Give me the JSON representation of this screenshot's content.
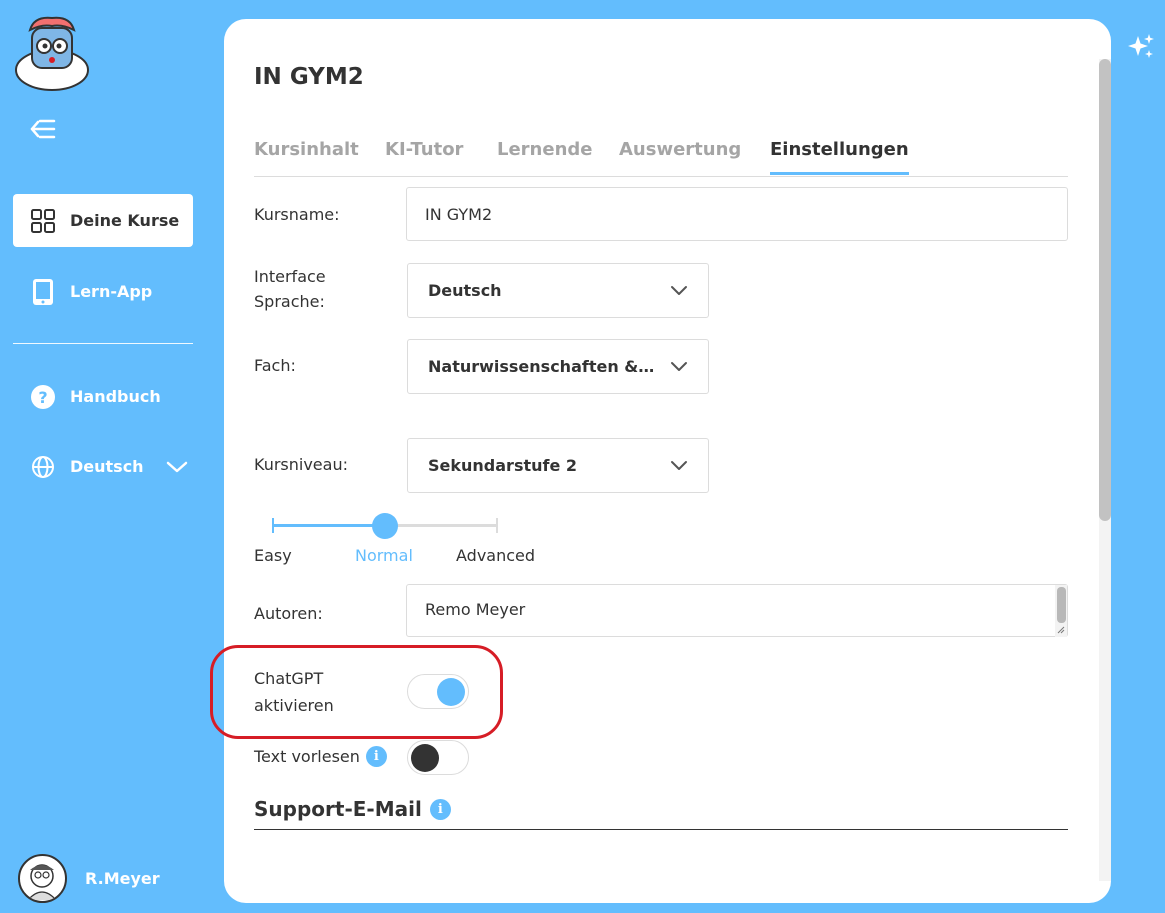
{
  "sidebar": {
    "nav": [
      {
        "label": "Deine Kurse",
        "icon": "grid-icon",
        "active": true
      },
      {
        "label": "Lern-App",
        "icon": "tablet-icon",
        "active": false
      }
    ],
    "handbuch_label": "Handbuch",
    "language_label": "Deutsch",
    "user_name": "R.Meyer"
  },
  "course": {
    "title": "IN GYM2",
    "tabs": [
      "Kursinhalt",
      "KI-Tutor",
      "Lernende",
      "Auswertung",
      "Einstellungen"
    ],
    "active_tab": "Einstellungen"
  },
  "settings": {
    "kursname_label": "Kursname:",
    "kursname_value": "IN GYM2",
    "interface_label_1": "Interface",
    "interface_label_2": "Sprache:",
    "interface_value": "Deutsch",
    "fach_label": "Fach:",
    "fach_value": "Naturwissenschaften & Mathematik",
    "kursniveau_label": "Kursniveau:",
    "kursniveau_value": "Sekundarstufe 2",
    "difficulty": {
      "options": [
        "Easy",
        "Normal",
        "Advanced"
      ],
      "selected": "Normal",
      "level": 0.5
    },
    "autoren_label": "Autoren:",
    "autoren_value": "Remo Meyer",
    "chatgpt_label_1": "ChatGPT",
    "chatgpt_label_2": "aktivieren",
    "chatgpt_enabled": true,
    "tts_label": "Text vorlesen",
    "tts_enabled": false,
    "support_title": "Support-E-Mail"
  },
  "colors": {
    "accent": "#63bdfd",
    "highlight": "#d61d26"
  }
}
